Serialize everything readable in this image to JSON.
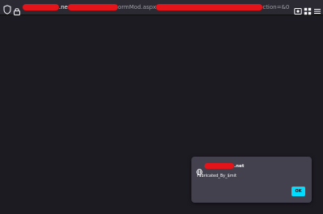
{
  "browser": {
    "url": {
      "segment_1": ".ne",
      "segment_2": "ormMod.aspx",
      "segment_3": "ction=&0=&"
    },
    "icons": [
      "shield-icon",
      "lock-icon",
      "screenshot-icon",
      "extensions-icon",
      "menu-icon"
    ]
  },
  "alert_dialog": {
    "origin_suffix": ".net",
    "message": "Fabricated_By_$mit",
    "ok_label": "OK",
    "accent_color": "#00ddff",
    "redaction_color": "#e3141a"
  }
}
